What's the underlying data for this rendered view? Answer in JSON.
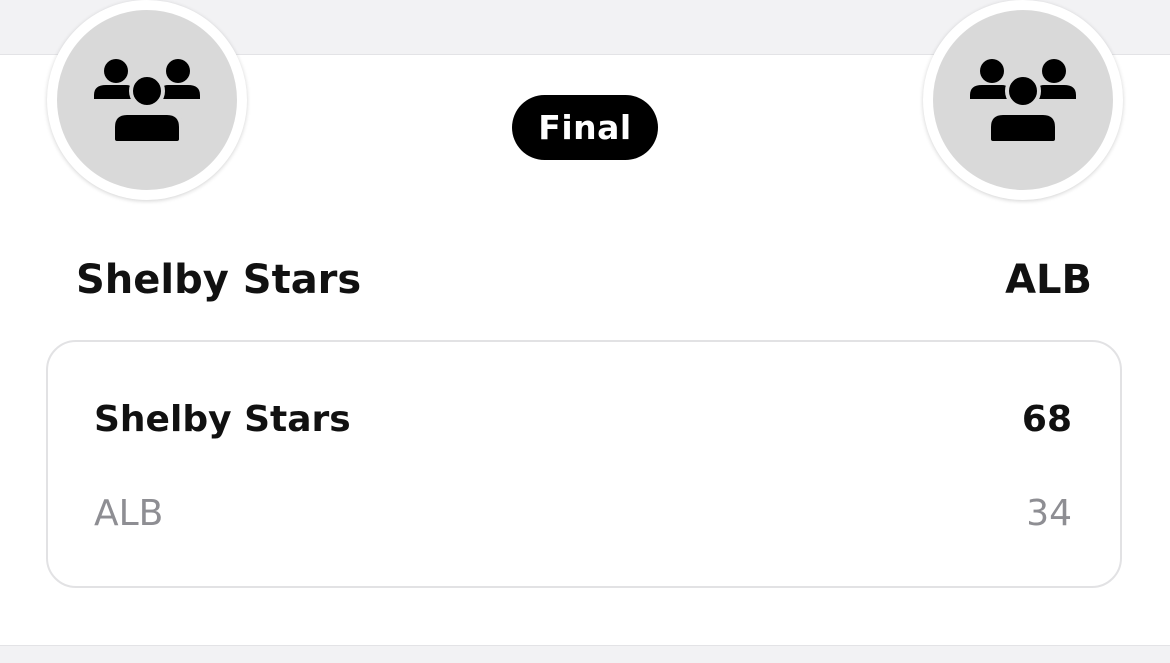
{
  "status": "Final",
  "home_team": {
    "name": "Shelby Stars",
    "icon": "team-group-icon"
  },
  "away_team": {
    "name": "ALB",
    "icon": "team-group-icon"
  },
  "scores": [
    {
      "team": "Shelby Stars",
      "score": "68",
      "winner": true
    },
    {
      "team": "ALB",
      "score": "34",
      "winner": false
    }
  ],
  "colors": {
    "pill_bg": "#000000",
    "pill_text": "#ffffff",
    "winner_text": "#111111",
    "loser_text": "#8e8e93",
    "avatar_bg": "#d9d9d9"
  }
}
